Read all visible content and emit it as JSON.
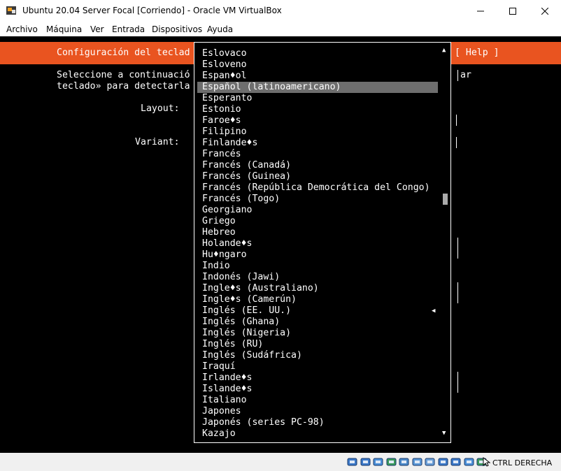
{
  "window": {
    "title": "Ubuntu 20.04 Server Focal [Corriendo] - Oracle VM VirtualBox"
  },
  "menu": [
    "Archivo",
    "Máquina",
    "Ver",
    "Entrada",
    "Dispositivos",
    "Ayuda"
  ],
  "installer": {
    "header_title": "Configuración del teclad",
    "help_label": "[ Help ]",
    "instructions_line1": "Seleccione a continuació",
    "instructions_line2": "teclado» para detectarla",
    "instructions_right": "ar",
    "layout_label": "Layout:",
    "variant_label": "Variant:"
  },
  "dropdown": {
    "selected_index": 3,
    "default_marker_index": 23,
    "items": [
      "Eslovaco",
      "Esloveno",
      "Espan♦ol",
      "Español (latinoamericano)",
      "Esperanto",
      "Estonio",
      "Faroe♦s",
      "Filipino",
      "Finlande♦s",
      "Francés",
      "Francés (Canadá)",
      "Francés (Guinea)",
      "Francés (República Democrática del Congo)",
      "Francés (Togo)",
      "Georgiano",
      "Griego",
      "Hebreo",
      "Holande♦s",
      "Hu♦ngaro",
      "Indio",
      "Indonés (Jawi)",
      "Ingle♦s (Australiano)",
      "Ingle♦s (Camerún)",
      "Inglés (EE. UU.)",
      "Inglés (Ghana)",
      "Inglés (Nigeria)",
      "Inglés (RU)",
      "Inglés (Sudáfrica)",
      "Iraquí",
      "Irlande♦s",
      "Islande♦s",
      "Italiano",
      "Japones",
      "Japonés (series PC-98)",
      "Kazajo"
    ]
  },
  "statusbar": {
    "host_key": "CTRL DERECHA",
    "icons": [
      "hard-disk-icon",
      "optical-drive-icon",
      "audio-icon",
      "network-icon",
      "usb-icon",
      "shared-folders-icon",
      "display-icon",
      "video-capture-icon",
      "cpu-icon",
      "mouse-integration-icon",
      "keyboard-icon",
      "arrow-icon"
    ]
  },
  "colors": {
    "header_bg": "#e95420",
    "terminal_bg": "#000000",
    "selection_bg": "#6e6e6e"
  }
}
